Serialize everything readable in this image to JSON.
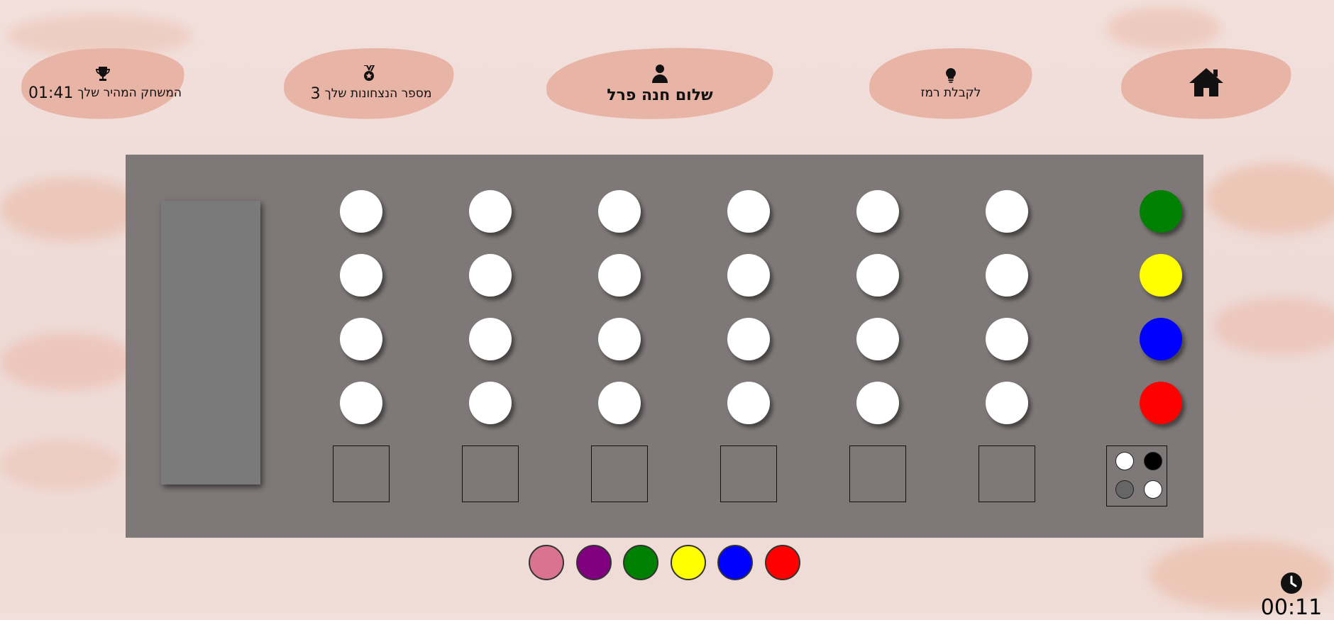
{
  "nav": {
    "fastest_label": "המשחק המהיר שלך",
    "fastest_time": "01:41",
    "wins_label": "מספר הנצחונות שלך",
    "wins_count": "3",
    "greeting": "שלום חנה פרל",
    "hint_label": "לקבלת רמז"
  },
  "icons": {
    "trophy": "trophy-icon",
    "medal": "medal-icon",
    "user": "user-icon",
    "lightbulb": "lightbulb-icon",
    "home": "home-icon",
    "clock": "clock-icon"
  },
  "board": {
    "rows": 4,
    "guess_columns": 6,
    "secret_colors": [
      "#008000",
      "#ffff00",
      "#0000ff",
      "#ff0000"
    ],
    "result_pegs": [
      "white",
      "black",
      "gray",
      "white"
    ]
  },
  "palette": [
    "#d97390",
    "#800080",
    "#008000",
    "#ffff00",
    "#0000ff",
    "#ff0000"
  ],
  "timer": {
    "elapsed": "00:11"
  }
}
